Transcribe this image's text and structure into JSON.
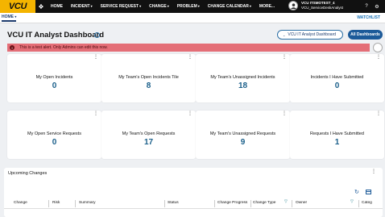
{
  "nav": {
    "logo": "VCU",
    "home_icon": "cube-icon",
    "items": [
      {
        "label": "HOME",
        "caret": ""
      },
      {
        "label": "INCIDENT",
        "caret": "▾"
      },
      {
        "label": "SERVICE REQUEST",
        "caret": "▾"
      },
      {
        "label": "CHANGE",
        "caret": "▾"
      },
      {
        "label": "PROBLEM",
        "caret": "▾"
      },
      {
        "label": "CHANGE CALENDAR",
        "caret": "▾"
      },
      {
        "label": "MORE...",
        "caret": ""
      }
    ],
    "user": {
      "name": "VCU ITSMOTEST_4",
      "role": "VCU_ServiceDeskAnalyst"
    }
  },
  "tabbar": {
    "home": "HOME",
    "watchlist": "WATCHLIST"
  },
  "dashboard": {
    "title": "VCU IT Analyst Dashboard",
    "selector": "VCU IT Analyst Dashboard",
    "all_button": "All Dashboards"
  },
  "alert": {
    "icon": "!",
    "text": "This is a test alert. Only Admins can edit this now."
  },
  "tiles": [
    {
      "label": "My Open Incidents",
      "value": "0"
    },
    {
      "label": "My Team's Open Incidents Tile",
      "value": "8"
    },
    {
      "label": "My Team's Unassigned Incidents",
      "value": "18"
    },
    {
      "label": "Incidents I Have Submitted",
      "value": "0"
    },
    {
      "label": "My Open Service Requests",
      "value": "0"
    },
    {
      "label": "My Team's Open Requests",
      "value": "17"
    },
    {
      "label": "My Team's Unassigned Requests",
      "value": "9"
    },
    {
      "label": "Requests I Have Submitted",
      "value": "1"
    }
  ],
  "changes": {
    "title": "Upcoming Changes",
    "columns": [
      "Change",
      "Risk",
      "Summary",
      "Status",
      "Change Progress",
      "Change Type",
      "Owner",
      "Categ"
    ]
  },
  "colors": {
    "nav_bg": "#111111",
    "logo_bg": "#f4b400",
    "accent": "#1c5a99",
    "alert_bg": "#e46e77",
    "tile_value": "#1a5f8a"
  }
}
